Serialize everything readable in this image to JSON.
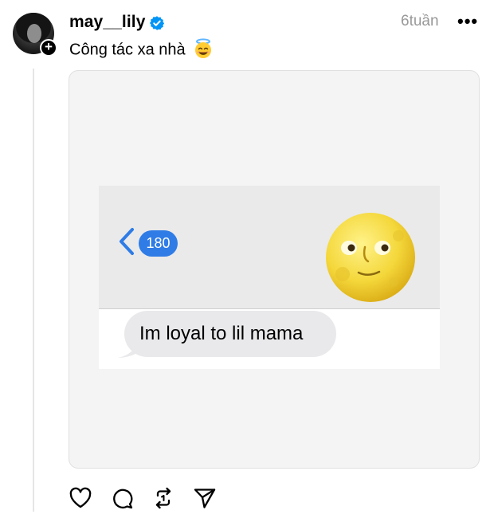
{
  "post": {
    "username": "may__lily",
    "timestamp": "6tuần",
    "caption": "Công tác xa nhà",
    "caption_emoji": "smiling-face-with-halo-emoji",
    "more_label": "•••",
    "follow_badge": "+"
  },
  "media": {
    "unread_count": "180",
    "bubble_text": "Im loyal to lil mama",
    "sticker": "full-moon-face-emoji"
  },
  "colors": {
    "verified": "#0095f6",
    "imessage_blue": "#2f7ce6",
    "timestamp": "#999999",
    "bubble": "#e9e9eb"
  },
  "actions": [
    {
      "name": "like",
      "icon": "heart-icon"
    },
    {
      "name": "reply",
      "icon": "comment-icon"
    },
    {
      "name": "repost",
      "icon": "repost-icon"
    },
    {
      "name": "share",
      "icon": "send-icon"
    }
  ]
}
